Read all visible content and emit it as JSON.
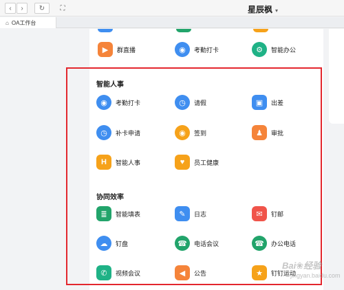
{
  "window": {
    "title": "星辰枫",
    "caret": "▾"
  },
  "nav": {
    "back_icon": "‹",
    "forward_icon": "›",
    "refresh_icon": "↻",
    "fullscreen_icon": "⛶"
  },
  "tabs": [
    {
      "label": "OA工作台",
      "icon": "home-icon"
    }
  ],
  "top_row": [
    {
      "label": "群直播",
      "icon": "live-broadcast-icon",
      "glyph": "▶",
      "color": "#f5843a"
    },
    {
      "label": "考勤打卡",
      "icon": "location-pin-icon",
      "glyph": "◉",
      "color": "#3f8ef0"
    },
    {
      "label": "智能办公",
      "icon": "smart-office-icon",
      "glyph": "⚙",
      "color": "#1fb286"
    }
  ],
  "sections": [
    {
      "title": "智能人事",
      "items": [
        {
          "label": "考勤打卡",
          "icon": "location-pin-icon",
          "glyph": "◉"
        },
        {
          "label": "请假",
          "icon": "clock-icon",
          "glyph": "◷"
        },
        {
          "label": "出差",
          "icon": "suitcase-icon",
          "glyph": "▣"
        },
        {
          "label": "补卡申请",
          "icon": "clock-icon",
          "glyph": "◷"
        },
        {
          "label": "签到",
          "icon": "location-pin-icon",
          "glyph": "◉"
        },
        {
          "label": "审批",
          "icon": "stamp-icon",
          "glyph": "♟"
        },
        {
          "label": "智能人事",
          "icon": "hr-icon",
          "glyph": "H"
        },
        {
          "label": "员工健康",
          "icon": "heart-icon",
          "glyph": "♥"
        }
      ]
    },
    {
      "title": "协同效率",
      "items": [
        {
          "label": "智能填表",
          "icon": "form-icon",
          "glyph": "≣"
        },
        {
          "label": "日志",
          "icon": "notebook-icon",
          "glyph": "✎"
        },
        {
          "label": "钉邮",
          "icon": "mail-icon",
          "glyph": "✉"
        },
        {
          "label": "钉盘",
          "icon": "cloud-drive-icon",
          "glyph": "☁"
        },
        {
          "label": "电话会议",
          "icon": "conference-call-icon",
          "glyph": "☎"
        },
        {
          "label": "办公电话",
          "icon": "office-phone-icon",
          "glyph": "☎"
        },
        {
          "label": "视频会议",
          "icon": "video-call-icon",
          "glyph": "✆"
        },
        {
          "label": "公告",
          "icon": "megaphone-icon",
          "glyph": "📢"
        },
        {
          "label": "钉钉运动",
          "icon": "running-icon",
          "glyph": "🏃"
        }
      ]
    }
  ],
  "colors": {
    "blue": "#3f8ef0",
    "orange": "#f6a21a",
    "red": "#f0544a",
    "green": "#22a46b",
    "teal": "#1fb286",
    "highlight_box": "#e3262d"
  },
  "watermark": {
    "brand": "Bai❀经验",
    "sub": "jingyan.baidu.com"
  }
}
